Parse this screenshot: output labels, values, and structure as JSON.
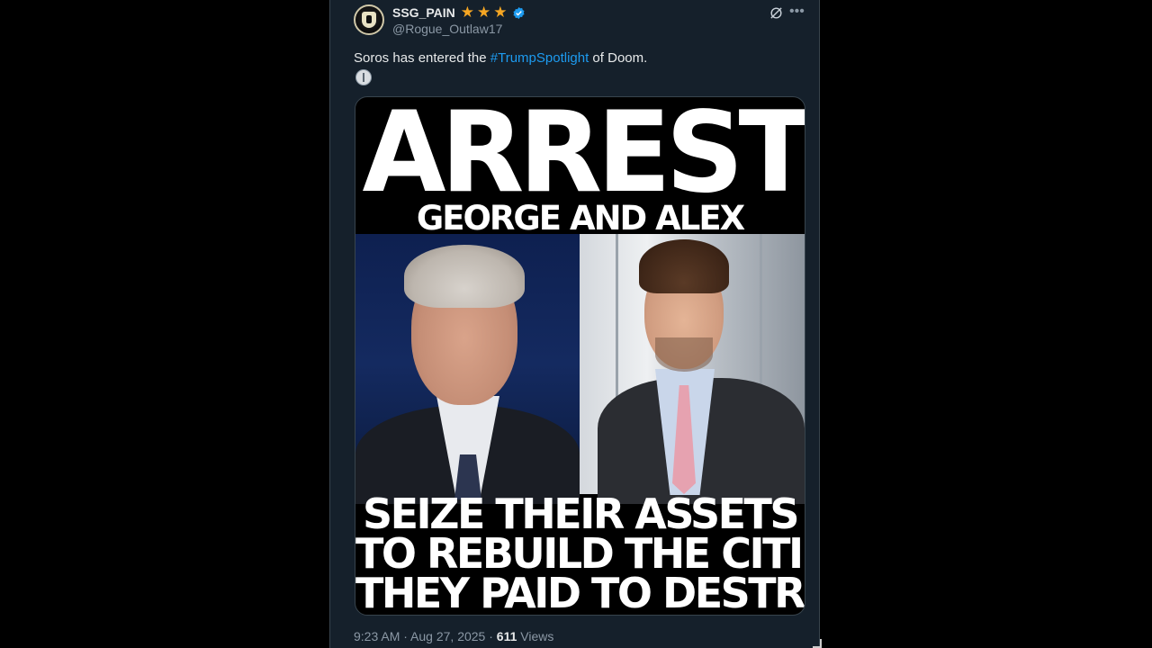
{
  "author": {
    "display_name": "SSG_PAIN",
    "stars": "★★★",
    "handle": "@Rogue_Outlaw17"
  },
  "tweet": {
    "text_before": "Soros has entered the ",
    "hashtag": "#TrumpSpotlight",
    "text_after": " of Doom."
  },
  "media": {
    "headline": "ARREST",
    "subheadline": "GEORGE AND ALEX SOROS",
    "bottom_lines": [
      "SEIZE THEIR ASSETS",
      "TO REBUILD THE CITIES",
      "THEY PAID TO DESTROY"
    ]
  },
  "meta": {
    "time": "9:23 AM",
    "sep1": " · ",
    "date": "Aug 27, 2025",
    "sep2": " · ",
    "views_count": "611",
    "views_label": " Views"
  },
  "colors": {
    "background": "#15202b",
    "hashtag": "#1d9bf0",
    "verified": "#1d9bf0",
    "star": "#f5a623"
  }
}
